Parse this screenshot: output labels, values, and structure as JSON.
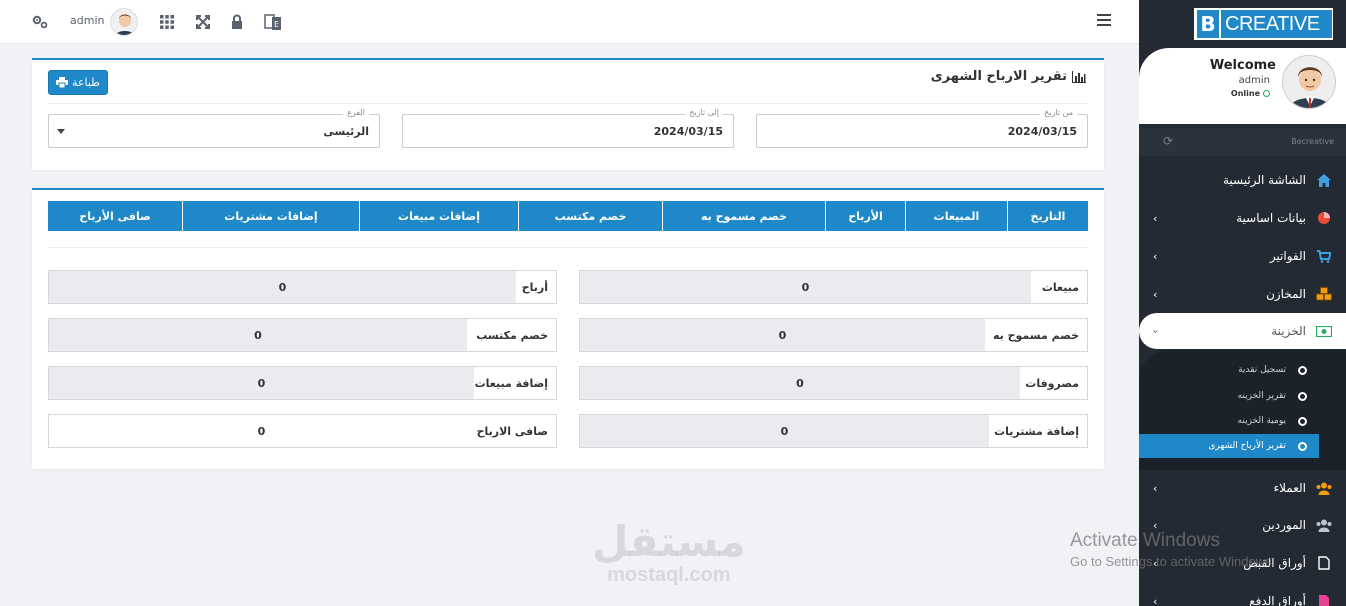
{
  "topbar": {
    "username": "admin",
    "icons": [
      "settings-icon",
      "avatar",
      "apps-grid-icon",
      "fullscreen-icon",
      "lock-icon",
      "language-icon",
      "menu-icon"
    ]
  },
  "report": {
    "title": "تقرير الارباح الشهرى",
    "print_label": "طباعة",
    "from_label": "من تاريخ",
    "from_value": "2024/03/15",
    "to_label": "إلى تاريخ",
    "to_value": "2024/03/15",
    "branch_label": "الفرع",
    "branch_value": "الرئيسى"
  },
  "table": {
    "headers": [
      "التاريخ",
      "المبيعات",
      "الأرباح",
      "خصم مسموح به",
      "خصم مكتسب",
      "إضافات مبيعات",
      "إضافات مشتريات",
      "صافى الأرباح"
    ]
  },
  "stats": {
    "sales_label": "مبيعات",
    "sales_value": "0",
    "profits_label": "أرباح",
    "profits_value": "0",
    "allowed_discount_label": "خصم مسموح به",
    "allowed_discount_value": "0",
    "earned_discount_label": "خصم مكتسب",
    "earned_discount_value": "0",
    "expenses_label": "مصروفات",
    "expenses_value": "0",
    "sales_additions_label": "إضافة مبيعات",
    "sales_additions_value": "0",
    "purchase_additions_label": "إضافة مشتريات",
    "purchase_additions_value": "0",
    "net_profit_label": "صافى الارباح",
    "net_profit_value": "0"
  },
  "sidebar": {
    "logo_letter": "B",
    "logo_text": "CREATIVE",
    "welcome": "Welcome",
    "user": "admin",
    "status": "Online",
    "brand": "Becreative",
    "items": [
      {
        "label": "الشاشة الرئيسية",
        "icon": "home-icon"
      },
      {
        "label": "بيانات اساسية",
        "icon": "pie-chart-icon"
      },
      {
        "label": "الفواتير",
        "icon": "cart-icon"
      },
      {
        "label": "المخازن",
        "icon": "cubes-icon"
      },
      {
        "label": "الخزينة",
        "icon": "money-icon"
      },
      {
        "label": "العملاء",
        "icon": "users-icon"
      },
      {
        "label": "الموردين",
        "icon": "group-icon"
      },
      {
        "label": "أوراق القبض",
        "icon": "file-icon"
      },
      {
        "label": "أوراق الدفع",
        "icon": "file-pink-icon"
      }
    ],
    "submenu": [
      {
        "label": "تسجيل نقدية"
      },
      {
        "label": "تقرير الخزينه"
      },
      {
        "label": "يومية الخزينه"
      },
      {
        "label": "تقرير الأرباح الشهرى"
      }
    ]
  },
  "watermarks": {
    "windows_line1": "Activate Windows",
    "windows_line2": "Go to Settings to activate Windows.",
    "mostaql_ar": "مستقل",
    "mostaql_en": "mostaql.com"
  },
  "colors": {
    "accent": "#1e88c8",
    "sidebar": "#232a33"
  }
}
